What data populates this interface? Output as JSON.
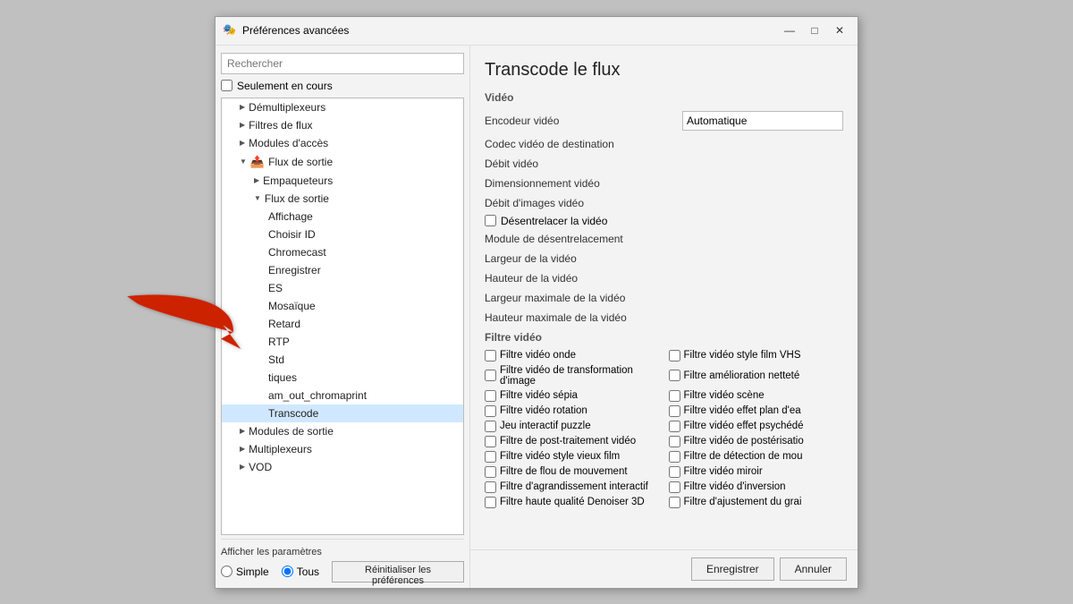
{
  "window": {
    "title": "Préférences avancées",
    "minimize_label": "—",
    "maximize_label": "□",
    "close_label": "✕"
  },
  "left": {
    "search_placeholder": "Rechercher",
    "checkbox_label": "Seulement en cours",
    "tree": [
      {
        "id": "demux",
        "label": "Démultiplexeurs",
        "level": 1,
        "arrow": "▶",
        "expanded": false
      },
      {
        "id": "filtres",
        "label": "Filtres de flux",
        "level": 1,
        "arrow": "▶",
        "expanded": false
      },
      {
        "id": "modules",
        "label": "Modules d'accès",
        "level": 1,
        "arrow": "▶",
        "expanded": false
      },
      {
        "id": "flux-sortie-parent",
        "label": "Flux de sortie",
        "level": 1,
        "arrow": "▼",
        "expanded": true,
        "hasIcon": true
      },
      {
        "id": "empaqueteurs",
        "label": "Empaqueteurs",
        "level": 2,
        "arrow": "▶",
        "expanded": false
      },
      {
        "id": "flux-sortie-child",
        "label": "Flux de sortie",
        "level": 2,
        "arrow": "▼",
        "expanded": true
      },
      {
        "id": "affichage",
        "label": "Affichage",
        "level": 3
      },
      {
        "id": "choisir-id",
        "label": "Choisir ID",
        "level": 3
      },
      {
        "id": "chromecast",
        "label": "Chromecast",
        "level": 3
      },
      {
        "id": "enregistrer",
        "label": "Enregistrer",
        "level": 3
      },
      {
        "id": "es",
        "label": "ES",
        "level": 3
      },
      {
        "id": "mosaique",
        "label": "Mosaïque",
        "level": 3
      },
      {
        "id": "retard",
        "label": "Retard",
        "level": 3
      },
      {
        "id": "rtp",
        "label": "RTP",
        "level": 3
      },
      {
        "id": "std",
        "label": "Std",
        "level": 3
      },
      {
        "id": "tiques",
        "label": "tiques",
        "level": 3
      },
      {
        "id": "stream-chromaprint",
        "label": "am_out_chromaprint",
        "level": 3
      },
      {
        "id": "transcode",
        "label": "Transcode",
        "level": 3,
        "selected": true
      },
      {
        "id": "modules-sortie",
        "label": "Modules de sortie",
        "level": 1,
        "arrow": "▶",
        "expanded": false
      },
      {
        "id": "multiplexeurs",
        "label": "Multiplexeurs",
        "level": 1,
        "arrow": "▶",
        "expanded": false
      },
      {
        "id": "vod",
        "label": "VOD",
        "level": 1,
        "arrow": "▶",
        "expanded": false
      }
    ],
    "bottom": {
      "section_label": "Afficher les paramètres",
      "radio_simple": "Simple",
      "radio_tous": "Tous",
      "btn_reinitialiser": "Réinitialiser les préférences"
    }
  },
  "right": {
    "title": "Transcode le flux",
    "section_video": "Vidéo",
    "fields": [
      {
        "label": "Encodeur vidéo",
        "value": "Automatique",
        "type": "input"
      },
      {
        "label": "Codec vidéo de destination",
        "type": "empty"
      },
      {
        "label": "Débit vidéo",
        "type": "empty"
      },
      {
        "label": "Dimensionnement vidéo",
        "type": "empty"
      },
      {
        "label": "Débit d'images vidéo",
        "type": "empty"
      },
      {
        "label": "Désentrelacer la vidéo",
        "type": "checkbox"
      },
      {
        "label": "Module de désentrelacement",
        "type": "empty"
      },
      {
        "label": "Largeur de la vidéo",
        "type": "empty"
      },
      {
        "label": "Hauteur de la vidéo",
        "type": "empty"
      },
      {
        "label": "Largeur maximale de la vidéo",
        "type": "empty"
      },
      {
        "label": "Hauteur maximale de la vidéo",
        "type": "empty"
      }
    ],
    "filter_section_label": "Filtre vidéo",
    "filters": [
      {
        "col": 1,
        "label": "Filtre vidéo onde"
      },
      {
        "col": 2,
        "label": "Filtre vidéo style film VHS"
      },
      {
        "col": 1,
        "label": "Filtre vidéo de transformation d'image"
      },
      {
        "col": 2,
        "label": "Filtre amélioration netteté"
      },
      {
        "col": 1,
        "label": "Filtre vidéo sépia"
      },
      {
        "col": 2,
        "label": "Filtre vidéo scène"
      },
      {
        "col": 1,
        "label": "Filtre vidéo rotation"
      },
      {
        "col": 2,
        "label": "Filtre vidéo effet plan d'ea"
      },
      {
        "col": 1,
        "label": "Jeu interactif puzzle"
      },
      {
        "col": 2,
        "label": "Filtre vidéo effet psychédé"
      },
      {
        "col": 1,
        "label": "Filtre de post-traitement vidéo"
      },
      {
        "col": 2,
        "label": "Filtre vidéo de postérisatio"
      },
      {
        "col": 1,
        "label": "Filtre vidéo style vieux film"
      },
      {
        "col": 2,
        "label": "Filtre de détection de mou"
      },
      {
        "col": 1,
        "label": "Filtre de flou de mouvement"
      },
      {
        "col": 2,
        "label": "Filtre vidéo miroir"
      },
      {
        "col": 1,
        "label": "Filtre d'agrandissement interactif"
      },
      {
        "col": 2,
        "label": "Filtre vidéo d'inversion"
      },
      {
        "col": 1,
        "label": "Filtre haute qualité Denoiser 3D"
      },
      {
        "col": 2,
        "label": "Filtre d'ajustement du grai"
      }
    ],
    "buttons": {
      "save": "Enregistrer",
      "cancel": "Annuler"
    }
  }
}
